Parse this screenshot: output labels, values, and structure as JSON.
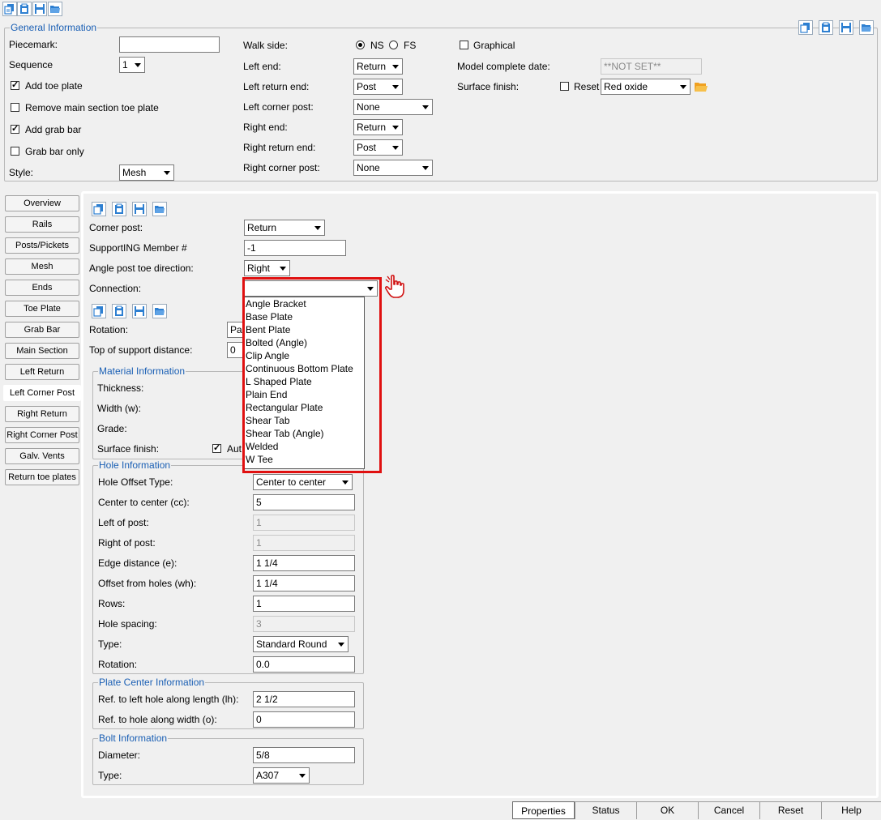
{
  "general": {
    "title": "General Information",
    "piecemark_label": "Piecemark:",
    "piecemark_value": "",
    "sequence_label": "Sequence",
    "sequence_value": "1",
    "add_toe_plate": "Add toe plate",
    "remove_toe_plate": "Remove main section toe plate",
    "add_grab_bar": "Add grab bar",
    "grab_bar_only": "Grab bar only",
    "style_label": "Style:",
    "style_value": "Mesh",
    "walk_side_label": "Walk side:",
    "ns": "NS",
    "fs": "FS",
    "left_end_label": "Left end:",
    "left_end_value": "Return",
    "left_return_end_label": "Left return end:",
    "left_return_end_value": "Post",
    "left_corner_post_label": "Left corner post:",
    "left_corner_post_value": "None",
    "right_end_label": "Right end:",
    "right_end_value": "Return",
    "right_return_end_label": "Right return end:",
    "right_return_end_value": "Post",
    "right_corner_post_label": "Right corner post:",
    "right_corner_post_value": "None",
    "graphical": "Graphical",
    "model_complete_label": "Model complete date:",
    "model_complete_value": "**NOT SET**",
    "surface_finish_label": "Surface finish:",
    "reset": "Reset",
    "surface_finish_value": "Red oxide"
  },
  "tabs": [
    "Overview",
    "Rails",
    "Posts/Pickets",
    "Mesh",
    "Ends",
    "Toe Plate",
    "Grab Bar",
    "Main Section",
    "Left Return",
    "Left Corner Post",
    "Right Return",
    "Right Corner Post",
    "Galv. Vents",
    "Return toe plates"
  ],
  "panel": {
    "corner_post_label": "Corner post:",
    "corner_post_value": "Return",
    "supporting_label": "SupportING Member #",
    "supporting_value": "-1",
    "angle_toe_label": "Angle post toe direction:",
    "angle_toe_value": "Right",
    "connection_label": "Connection:",
    "connection_value": "",
    "rotation_label": "Rotation:",
    "rotation_value": "Par",
    "top_support_label": "Top of support distance:",
    "top_support_value": "0"
  },
  "material": {
    "title": "Material Information",
    "thickness": "Thickness:",
    "width": "Width (w):",
    "grade": "Grade:",
    "surface_finish": "Surface finish:",
    "auto": "Aut"
  },
  "hole": {
    "title": "Hole Information",
    "offset_type_label": "Hole Offset Type:",
    "offset_type_value": "Center to center",
    "cc_label": "Center to center (cc):",
    "cc_value": "5",
    "left_label": "Left of post:",
    "left_value": "1",
    "right_label": "Right of post:",
    "right_value": "1",
    "edge_label": "Edge distance (e):",
    "edge_value": "1 1/4",
    "offset_label": "Offset from holes (wh):",
    "offset_value": "1 1/4",
    "rows_label": "Rows:",
    "rows_value": "1",
    "spacing_label": "Hole spacing:",
    "spacing_value": "3",
    "type_label": "Type:",
    "type_value": "Standard Round",
    "rotation_label": "Rotation:",
    "rotation_value": "0.0"
  },
  "plate_center": {
    "title": "Plate Center Information",
    "lh_label": "Ref. to left hole along length (lh):",
    "lh_value": "2 1/2",
    "o_label": "Ref. to hole along width (o):",
    "o_value": "0"
  },
  "bolt": {
    "title": "Bolt Information",
    "diameter_label": "Diameter:",
    "diameter_value": "5/8",
    "type_label": "Type:",
    "type_value": "A307"
  },
  "dropdown_items": [
    "Angle Bracket",
    "Base Plate",
    "Bent Plate",
    "Bolted (Angle)",
    "Clip Angle",
    "Continuous Bottom Plate",
    "L Shaped Plate",
    "Plain End",
    "Rectangular Plate",
    "Shear Tab",
    "Shear Tab (Angle)",
    "Welded",
    "W Tee"
  ],
  "bottom_buttons": [
    "Properties",
    "Status",
    "OK",
    "Cancel",
    "Reset",
    "Help"
  ],
  "colors": {
    "highlight_red": "#e01010",
    "group_title_blue": "#1a5fb4",
    "folder_orange": "#f0a020"
  },
  "icons": [
    "copy-icon",
    "paste-icon",
    "save-icon",
    "open-folder-icon",
    "hand-cursor-icon"
  ]
}
